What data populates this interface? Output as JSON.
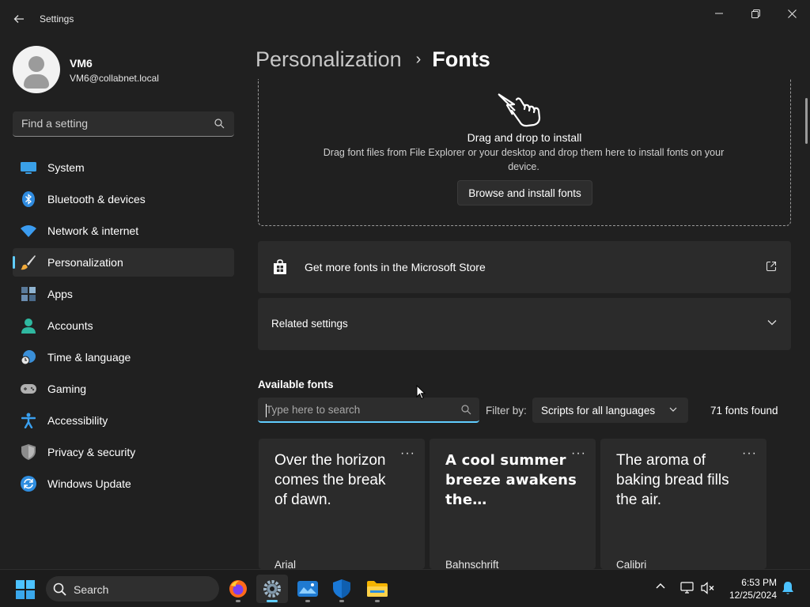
{
  "window": {
    "title": "Settings",
    "controls": [
      "minimize",
      "maximize",
      "close"
    ]
  },
  "profile": {
    "name": "VM6",
    "email": "VM6@collabnet.local"
  },
  "sidebar": {
    "search_placeholder": "Find a setting",
    "items": [
      {
        "label": "System",
        "icon": "monitor-icon"
      },
      {
        "label": "Bluetooth & devices",
        "icon": "bluetooth-icon"
      },
      {
        "label": "Network & internet",
        "icon": "wifi-icon"
      },
      {
        "label": "Personalization",
        "icon": "paintbrush-icon",
        "active": true
      },
      {
        "label": "Apps",
        "icon": "apps-icon"
      },
      {
        "label": "Accounts",
        "icon": "accounts-icon"
      },
      {
        "label": "Time & language",
        "icon": "globe-clock-icon"
      },
      {
        "label": "Gaming",
        "icon": "gamepad-icon"
      },
      {
        "label": "Accessibility",
        "icon": "accessibility-icon"
      },
      {
        "label": "Privacy & security",
        "icon": "shield-icon"
      },
      {
        "label": "Windows Update",
        "icon": "update-icon"
      }
    ]
  },
  "header": {
    "parent": "Personalization",
    "separator": "›",
    "current": "Fonts"
  },
  "dropzone": {
    "title": "Drag and drop to install",
    "description": "Drag font files from File Explorer or your desktop and drop them here to install fonts on your device.",
    "button": "Browse and install fonts"
  },
  "store_card": {
    "label": "Get more fonts in the Microsoft Store"
  },
  "related": {
    "label": "Related settings"
  },
  "available": {
    "title": "Available fonts",
    "search_placeholder": "Type here to search",
    "filter_label": "Filter by:",
    "filter_value": "Scripts for all languages",
    "count_text": "71 fonts found",
    "fonts": [
      {
        "sample": "Over the horizon comes the break of dawn.",
        "name": "Arial"
      },
      {
        "sample": "A cool summer breeze awakens the…",
        "name": "Bahnschrift"
      },
      {
        "sample": "The aroma of baking bread fills the air.",
        "name": "Calibri"
      }
    ],
    "more_glyph": "···"
  },
  "taskbar": {
    "search_label": "Search",
    "apps": [
      {
        "name": "firefox-icon"
      },
      {
        "name": "settings-icon",
        "active": true
      },
      {
        "name": "photos-icon"
      },
      {
        "name": "defender-icon"
      },
      {
        "name": "file-explorer-icon"
      }
    ],
    "time": "6:53 PM",
    "date": "12/25/2024"
  },
  "colors": {
    "accent": "#60cdff",
    "background": "#202020",
    "card": "#2b2b2b"
  }
}
